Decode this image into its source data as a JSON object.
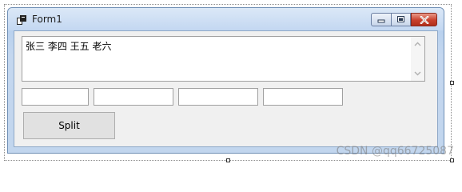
{
  "window": {
    "title": "Form1",
    "accent": "#c3d7f1",
    "close_color": "#c8402c"
  },
  "icons": {
    "app": "form-app-icon",
    "minimize": "minimize-icon",
    "maximize": "maximize-icon",
    "close": "close-icon",
    "scroll_up": "scroll-up-arrow-icon",
    "scroll_down": "scroll-down-arrow-icon"
  },
  "form": {
    "multiline_text": "张三 李四 王五 老六",
    "textboxes": [
      "",
      "",
      "",
      ""
    ],
    "split_label": "Split"
  },
  "watermark": "CSDN @qq66725087"
}
